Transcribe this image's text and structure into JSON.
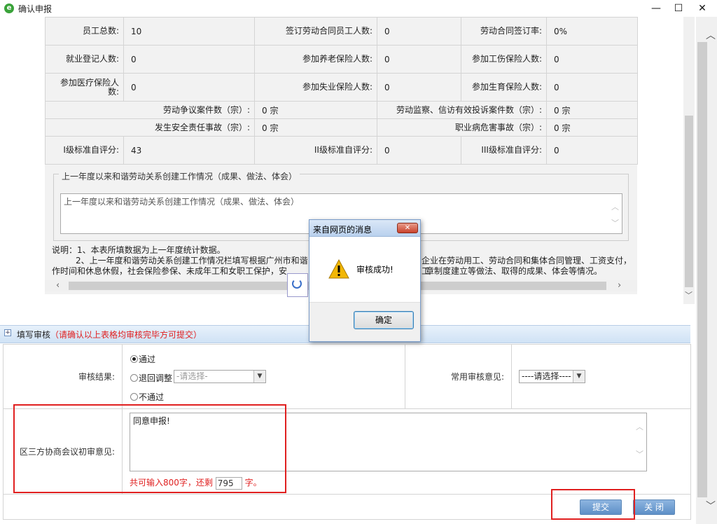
{
  "window": {
    "title": "确认申报",
    "minimize": "—",
    "maximize": "☐",
    "close": "✕"
  },
  "stats": [
    {
      "label": "员工总数:",
      "value": "10"
    },
    {
      "label": "签订劳动合同员工人数:",
      "value": "0"
    },
    {
      "label": "劳动合同签订率:",
      "value": "0%"
    },
    {
      "label": "就业登记人数:",
      "value": "0"
    },
    {
      "label": "参加养老保险人数:",
      "value": "0"
    },
    {
      "label": "参加工伤保险人数:",
      "value": "0"
    },
    {
      "label": "参加医疗保险人数:",
      "value": "0"
    },
    {
      "label": "参加失业保险人数:",
      "value": "0"
    },
    {
      "label": "参加生育保险人数:",
      "value": "0"
    }
  ],
  "cases": [
    {
      "label": "劳动争议案件数（宗）:",
      "value": "0 宗"
    },
    {
      "label": "劳动监察、信访有效投诉案件数（宗）:",
      "value": "0 宗"
    },
    {
      "label": "发生安全责任事故（宗）:",
      "value": "0 宗"
    },
    {
      "label": "职业病危害事故（宗）:",
      "value": "0 宗"
    }
  ],
  "scores": [
    {
      "label": "I级标准自评分:",
      "value": "43"
    },
    {
      "label": "II级标准自评分:",
      "value": "0"
    },
    {
      "label": "III级标准自评分:",
      "value": "0"
    }
  ],
  "work_section": {
    "legend": "上一年度以来和谐劳动关系创建工作情况（成果、做法、体会）",
    "textarea": "上一年度以来和谐劳动关系创建工作情况（成果、做法、体会）"
  },
  "notes": {
    "line1": "说明：1、本表所填数据为上一年度统计数据。",
    "line2a": "2、上一年度和谐劳动关系创建工作情况栏填写根据广州市和谐",
    "line2b": "企业在劳动用工、劳动合同和集体合同管理、工资支付，工",
    "line3a": "作时间和休息休假，社会保险参保、未成年工和女职工保护，安",
    "line3b": "章制度建立等做法、取得的成果、体会等情况。"
  },
  "review": {
    "section_title": "填写审核",
    "section_note": "（请确认以上表格均审核完毕方可提交）",
    "result_label": "审核结果:",
    "options": [
      "通过",
      "退回调整",
      "不通过"
    ],
    "selected": "通过",
    "return_select": "-请选择-",
    "common_label": "常用审核意见:",
    "common_select": "----请选择----",
    "opinion_label": "区三方协商会议初审意见:",
    "opinion_text": "同意申报!",
    "counter_prefix": "共可输入800字，还剩",
    "counter_value": "795",
    "counter_suffix": "字。",
    "submit": "提交",
    "close": "关 闭"
  },
  "dialog": {
    "title": "来自网页的消息",
    "message": "审核成功!",
    "ok": "确定"
  },
  "colors": {
    "accent": "#5d8fc7",
    "highlight": "#e02020",
    "warning": "#f2b705"
  }
}
